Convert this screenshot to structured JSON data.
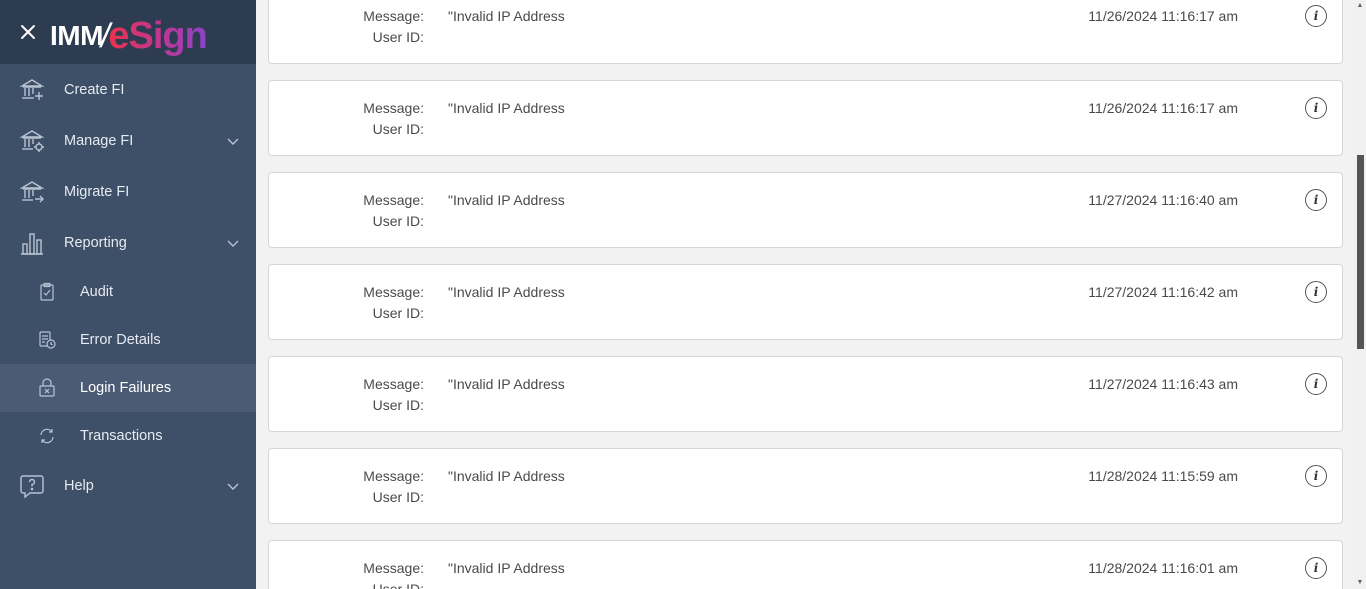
{
  "brand": {
    "logo_part1": "IMM",
    "logo_slash": "/",
    "logo_part2": "eSign"
  },
  "sidebar": {
    "items": [
      {
        "label": "Create FI",
        "icon": "bank-add-icon"
      },
      {
        "label": "Manage FI",
        "icon": "bank-gear-icon"
      },
      {
        "label": "Migrate FI",
        "icon": "bank-arrow-icon"
      },
      {
        "label": "Reporting",
        "icon": "bar-chart-icon"
      },
      {
        "label": "Help",
        "icon": "help-bubble-icon"
      }
    ],
    "reporting_subitems": [
      {
        "label": "Audit",
        "icon": "clipboard-check-icon"
      },
      {
        "label": "Error Details",
        "icon": "document-clock-icon"
      },
      {
        "label": "Login Failures",
        "icon": "lock-x-icon",
        "active": true
      },
      {
        "label": "Transactions",
        "icon": "refresh-cycle-icon"
      }
    ]
  },
  "records": [
    {
      "message_label": "Message:",
      "userid_label": "User ID:",
      "message": "\"Invalid IP Address",
      "timestamp": "11/26/2024 11:16:17 am"
    },
    {
      "message_label": "Message:",
      "userid_label": "User ID:",
      "message": "\"Invalid IP Address",
      "timestamp": "11/26/2024 11:16:17 am"
    },
    {
      "message_label": "Message:",
      "userid_label": "User ID:",
      "message": "\"Invalid IP Address",
      "timestamp": "11/27/2024 11:16:40 am"
    },
    {
      "message_label": "Message:",
      "userid_label": "User ID:",
      "message": "\"Invalid IP Address",
      "timestamp": "11/27/2024 11:16:42 am"
    },
    {
      "message_label": "Message:",
      "userid_label": "User ID:",
      "message": "\"Invalid IP Address",
      "timestamp": "11/27/2024 11:16:43 am"
    },
    {
      "message_label": "Message:",
      "userid_label": "User ID:",
      "message": "\"Invalid IP Address",
      "timestamp": "11/28/2024 11:15:59 am"
    },
    {
      "message_label": "Message:",
      "userid_label": "User ID:",
      "message": "\"Invalid IP Address",
      "timestamp": "11/28/2024 11:16:01 am"
    }
  ],
  "info_glyph": "i",
  "colors": {
    "sidebar_bg": "#3e4f68",
    "brand_bg": "#2e3c52",
    "active_item_bg": "#4b5b73",
    "content_bg": "#f2f2f2"
  }
}
